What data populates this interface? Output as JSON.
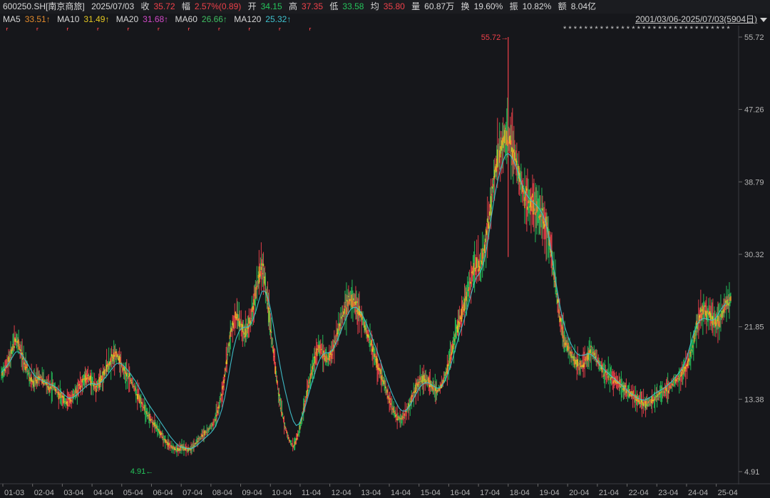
{
  "header": {
    "code": "600250.SH[南京商旅]",
    "date": "2025/07/03",
    "close_label": "收",
    "close": "35.72",
    "change_label": "幅",
    "change": "2.57%(0.89)",
    "open_label": "开",
    "open": "34.15",
    "high_label": "高",
    "high": "37.35",
    "low_label": "低",
    "low": "33.58",
    "avg_label": "均",
    "avg": "35.80",
    "vol_label": "量",
    "vol": "60.87万",
    "turn_label": "换",
    "turn": "19.60%",
    "amp_label": "振",
    "amp": "10.82%",
    "amt_label": "额",
    "amt": "8.04亿"
  },
  "ma": [
    {
      "name": "MA5",
      "value": "33.51↑",
      "color": "#e38b2c"
    },
    {
      "name": "MA10",
      "value": "31.49↑",
      "color": "#e5c822"
    },
    {
      "name": "MA20",
      "value": "31.68↑",
      "color": "#d249c8"
    },
    {
      "name": "MA60",
      "value": "26.66↑",
      "color": "#3fbf62"
    },
    {
      "name": "MA120",
      "value": "25.32↑",
      "color": "#40c2cf"
    }
  ],
  "date_range": "2001/03/06-2025/07/03(5904日)",
  "chart_data": {
    "type": "line",
    "ylim": [
      4.91,
      55.72
    ],
    "y_ticks": [
      "55.72",
      "47.26",
      "38.79",
      "30.32",
      "21.85",
      "13.38",
      "4.91"
    ],
    "x_ticks": [
      "01-03",
      "02-04",
      "03-04",
      "04-04",
      "05-04",
      "06-04",
      "07-04",
      "08-04",
      "09-04",
      "10-04",
      "11-04",
      "12-04",
      "13-04",
      "14-04",
      "15-04",
      "16-04",
      "17-04",
      "18-04",
      "19-04",
      "20-04",
      "21-04",
      "22-04",
      "23-04",
      "24-04",
      "25-04"
    ],
    "max_label": "55.72",
    "min_label": "4.91",
    "colors": {
      "up": "#f0414a",
      "down": "#25c55b",
      "ma_short": "#e5c822",
      "ma_long": "#40c2cf"
    },
    "series": [
      {
        "values": [
          16.2,
          16.8,
          17.5,
          18.2,
          19.5,
          20.6,
          19.8,
          18.6,
          17.6,
          16.9,
          15.9,
          15.2,
          15.6,
          16.1,
          15.8,
          15.4,
          15.1,
          14.7,
          15.0,
          14.5,
          14.0,
          13.6,
          13.2,
          13.0,
          13.3,
          13.8,
          14.3,
          14.8,
          15.3,
          15.8,
          16.1,
          15.7,
          15.2,
          14.7,
          15.2,
          15.8,
          16.5,
          17.2,
          17.6,
          18.3,
          18.7,
          18.1,
          17.4,
          16.6,
          16.1,
          15.6,
          15.1,
          14.4,
          13.6,
          12.9,
          12.2,
          11.6,
          11.1,
          10.6,
          10.2,
          9.7,
          9.2,
          8.7,
          8.2,
          7.9,
          7.7,
          7.5,
          7.6,
          7.8,
          7.6,
          7.5,
          7.6,
          7.9,
          8.3,
          8.7,
          9.1,
          9.4,
          9.7,
          10.1,
          10.6,
          11.5,
          12.6,
          14.0,
          16.1,
          18.6,
          20.9,
          22.3,
          23.0,
          22.4,
          21.6,
          21.0,
          21.6,
          22.7,
          24.2,
          26.0,
          27.8,
          28.9,
          27.1,
          24.6,
          21.8,
          18.9,
          16.0,
          13.6,
          11.9,
          10.3,
          9.1,
          8.3,
          7.8,
          8.6,
          9.8,
          11.3,
          12.9,
          14.5,
          16.0,
          17.4,
          18.7,
          19.5,
          19.0,
          18.3,
          18.0,
          18.6,
          19.5,
          20.6,
          21.8,
          22.9,
          23.8,
          24.6,
          25.1,
          24.8,
          24.3,
          23.6,
          22.8,
          21.8,
          20.8,
          19.8,
          18.8,
          17.8,
          16.8,
          15.8,
          14.8,
          13.8,
          12.9,
          12.1,
          11.4,
          11.0,
          11.2,
          11.7,
          12.4,
          13.2,
          14.1,
          14.8,
          15.3,
          15.7,
          15.8,
          15.5,
          15.0,
          14.6,
          14.4,
          14.6,
          15.2,
          16.1,
          17.2,
          18.6,
          20.0,
          21.3,
          22.4,
          23.5,
          24.7,
          26.0,
          27.4,
          28.6,
          29.2,
          29.0,
          29.8,
          31.5,
          33.6,
          36.5,
          39.2,
          41.0,
          42.5,
          43.5,
          44.2,
          43.8,
          43.0,
          42.0,
          40.8,
          39.4,
          38.0,
          37.0,
          36.6,
          36.2,
          35.9,
          35.7,
          35.3,
          34.7,
          33.9,
          32.6,
          30.6,
          28.1,
          25.5,
          23.0,
          21.2,
          20.0,
          19.3,
          18.6,
          18.0,
          17.5,
          17.2,
          17.5,
          18.0,
          18.5,
          18.9,
          18.6,
          18.0,
          17.4,
          16.8,
          16.4,
          16.2,
          16.0,
          15.7,
          15.4,
          15.1,
          14.8,
          14.5,
          14.2,
          13.9,
          13.6,
          13.3,
          13.1,
          13.0,
          12.9,
          13.0,
          13.2,
          13.5,
          13.8,
          14.1,
          14.3,
          14.5,
          14.7,
          15.0,
          15.4,
          15.8,
          16.2,
          16.6,
          17.0,
          17.8,
          19.0,
          20.6,
          22.1,
          23.2,
          23.6,
          23.7,
          23.5,
          23.0,
          22.6,
          22.4,
          22.8,
          23.6,
          24.4,
          24.9,
          25.3
        ]
      },
      {
        "values": [
          16.5,
          16.9,
          17.3,
          17.8,
          18.4,
          18.9,
          18.9,
          18.6,
          18.1,
          17.6,
          17.0,
          16.4,
          16.0,
          15.8,
          15.6,
          15.4,
          15.3,
          15.1,
          15.0,
          14.8,
          14.5,
          14.2,
          13.9,
          13.6,
          13.5,
          13.6,
          13.8,
          14.1,
          14.4,
          14.7,
          15.0,
          15.2,
          15.2,
          15.1,
          15.2,
          15.4,
          15.8,
          16.2,
          16.7,
          17.1,
          17.5,
          17.6,
          17.5,
          17.2,
          16.8,
          16.4,
          15.9,
          15.4,
          14.8,
          14.2,
          13.6,
          13.0,
          12.5,
          12.0,
          11.5,
          11.0,
          10.5,
          10.0,
          9.5,
          9.0,
          8.6,
          8.2,
          7.9,
          7.8,
          7.7,
          7.6,
          7.6,
          7.7,
          7.9,
          8.2,
          8.5,
          8.8,
          9.1,
          9.4,
          9.8,
          10.4,
          11.2,
          12.2,
          13.6,
          15.4,
          17.4,
          19.2,
          20.5,
          21.3,
          21.7,
          21.8,
          21.8,
          22.1,
          22.8,
          23.8,
          25.0,
          26.0,
          26.0,
          25.3,
          23.9,
          22.0,
          19.9,
          17.9,
          16.1,
          14.5,
          13.1,
          11.8,
          10.8,
          10.3,
          10.5,
          11.3,
          12.4,
          13.6,
          14.8,
          15.9,
          17.0,
          17.9,
          18.5,
          18.8,
          18.8,
          18.9,
          19.3,
          20.0,
          20.8,
          21.7,
          22.5,
          23.3,
          23.9,
          24.1,
          24.1,
          23.8,
          23.3,
          22.6,
          21.8,
          21.0,
          20.1,
          19.2,
          18.2,
          17.2,
          16.2,
          15.3,
          14.4,
          13.6,
          12.9,
          12.3,
          12.0,
          12.0,
          12.3,
          12.8,
          13.5,
          14.1,
          14.7,
          15.1,
          15.3,
          15.3,
          15.1,
          14.9,
          14.7,
          14.7,
          15.0,
          15.6,
          16.4,
          17.4,
          18.6,
          19.8,
          21.0,
          22.0,
          23.1,
          24.3,
          25.6,
          26.8,
          27.7,
          28.1,
          28.8,
          30.2,
          32.1,
          34.4,
          36.6,
          38.4,
          39.8,
          41.0,
          41.9,
          42.1,
          41.8,
          41.2,
          40.3,
          39.3,
          38.3,
          37.5,
          37.0,
          36.6,
          36.3,
          36.0,
          35.6,
          35.0,
          34.1,
          32.7,
          30.8,
          28.6,
          26.4,
          24.4,
          22.8,
          21.6,
          20.6,
          19.8,
          19.2,
          18.7,
          18.5,
          18.5,
          18.6,
          18.7,
          18.6,
          18.3,
          17.9,
          17.4,
          17.0,
          16.7,
          16.4,
          16.1,
          15.8,
          15.5,
          15.2,
          14.9,
          14.6,
          14.3,
          14.0,
          13.8,
          13.5,
          13.4,
          13.3,
          13.3,
          13.5,
          13.7,
          14.0,
          14.2,
          14.4,
          14.6,
          14.8,
          15.1,
          15.4,
          15.8,
          16.2,
          16.6,
          17.1,
          17.9,
          19.0,
          20.2,
          21.3,
          22.1,
          22.6,
          22.8,
          22.8,
          22.7,
          22.6,
          22.7,
          23.1,
          23.7,
          24.2,
          24.6
        ]
      }
    ]
  }
}
